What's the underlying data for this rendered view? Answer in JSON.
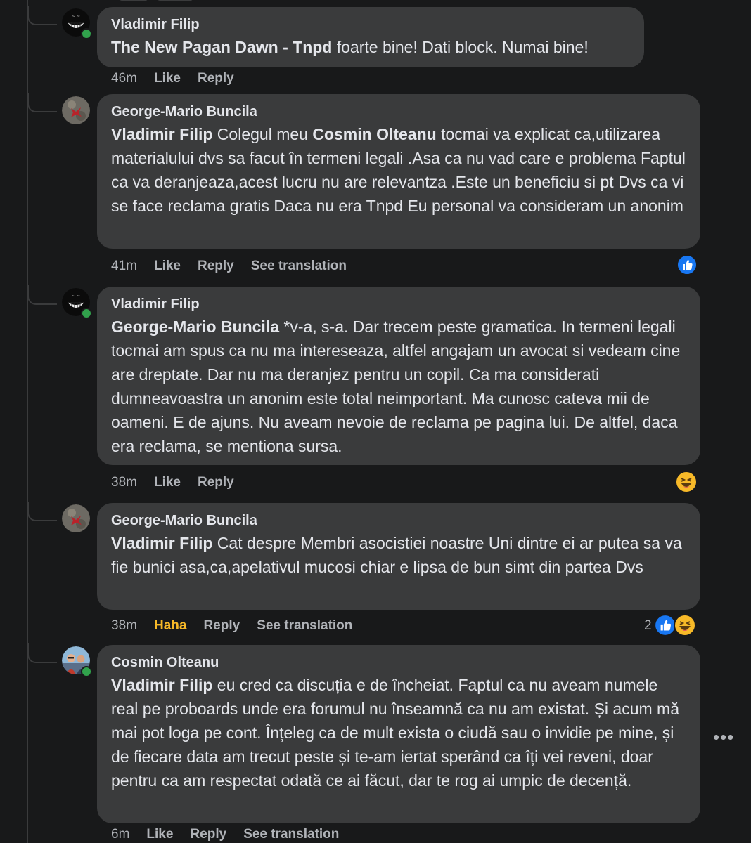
{
  "comments": [
    {
      "author": "Vladimir Filip",
      "mention": "The New Pagan Dawn - Tnpd",
      "text": " foarte bine! Dati block. Numai bine!",
      "time": "46m",
      "like": "Like",
      "reply": "Reply"
    },
    {
      "author": "George-Mario Buncila",
      "mention": "Vladimir Filip",
      "text_a": " Colegul meu ",
      "mention2": "Cosmin Olteanu",
      "text_b": " tocmai va explicat ca,utilizarea materialului dvs sa facut în termeni legali .Asa ca nu vad care e problema Faptul ca va deranjeaza,acest lucru nu are relevantza .Este un beneficiu si pt Dvs ca vi se face reclama gratis Daca nu era Tnpd Eu personal va consideram un anonim",
      "time": "41m",
      "like": "Like",
      "reply": "Reply",
      "translate": "See translation",
      "reaction": "like-reaction-icon"
    },
    {
      "author": "Vladimir Filip",
      "mention": "George-Mario Buncila",
      "text": " *v-a, s-a. Dar trecem peste gramatica. In termeni legali tocmai am spus ca nu ma intereseaza, altfel angajam un avocat si vedeam cine are dreptate. Dar nu ma deranjez pentru un copil. Ca ma considerati dumneavoastra un anonim este total neimportant. Ma cunosc cateva mii de oameni. E de ajuns. Nu aveam nevoie de reclama pe pagina lui. De altfel, daca era reclama, se mentiona sursa.",
      "time": "38m",
      "like": "Like",
      "reply": "Reply",
      "reaction": "haha-reaction-icon"
    },
    {
      "author": "George-Mario Buncila",
      "mention": "Vladimir Filip",
      "text": " Cat despre Membri asocistiei noastre Uni dintre ei ar putea sa va fie bunici asa,ca,apelativul mucosi chiar e lipsa de bun simt din partea Dvs",
      "time": "38m",
      "like": "Haha",
      "reply": "Reply",
      "translate": "See translation",
      "reaction_count": "2"
    },
    {
      "author": "Cosmin Olteanu",
      "mention": "Vladimir Filip",
      "text": " eu cred ca discuția e de încheiat. Faptul ca nu aveam numele real pe proboards unde era forumul nu înseamnă ca nu am existat. Și acum mă mai pot loga pe cont. Înțeleg ca de mult exista o ciudă sau o invidie pe mine, și de fiecare data am trecut peste și te-am iertat sperând ca îți vei reveni, doar pentru ca am respectat odată ce ai făcut, dar te rog ai umpic de decență.",
      "time": "6m",
      "like": "Like",
      "reply": "Reply",
      "translate": "See translation"
    }
  ],
  "more_options": "•••",
  "colors": {
    "like_blue": "#1877f2",
    "haha_yellow": "#f7b928",
    "bubble": "#3a3b3c",
    "background": "#18191a"
  }
}
